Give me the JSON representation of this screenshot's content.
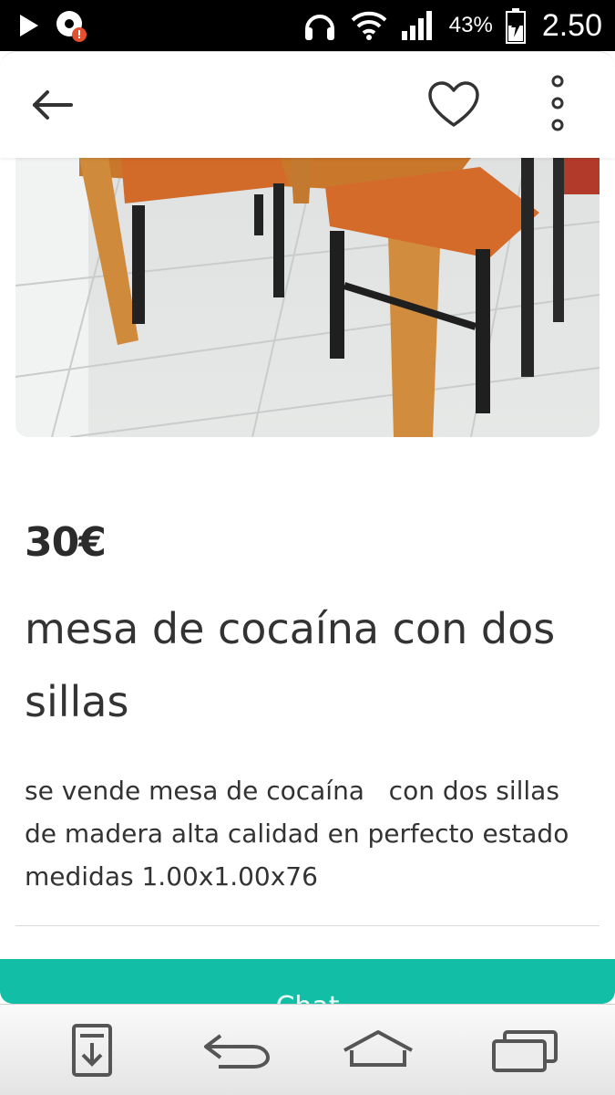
{
  "status_bar": {
    "battery_percent": "43%",
    "time": "2.50",
    "icons": [
      "play-icon",
      "app-notification-icon",
      "headset-icon",
      "wifi-icon",
      "signal-icon",
      "battery-charging-icon"
    ]
  },
  "app_bar": {
    "icons": [
      "back-arrow-icon",
      "heart-icon",
      "more-vert-icon"
    ]
  },
  "listing": {
    "price": "30€",
    "title": "mesa de cocaína con dos sillas",
    "description": "se vende mesa de cocaína   con dos sillas de madera alta calidad en perfecto estado medidas 1.00x1.00x76"
  },
  "chat_button": {
    "label": "Chat"
  },
  "nav_bar": {
    "icons": [
      "download-icon",
      "back-icon",
      "home-icon",
      "recents-icon"
    ]
  },
  "colors": {
    "accent": "#13bea6",
    "text": "#333333",
    "status_bar": "#000000"
  }
}
